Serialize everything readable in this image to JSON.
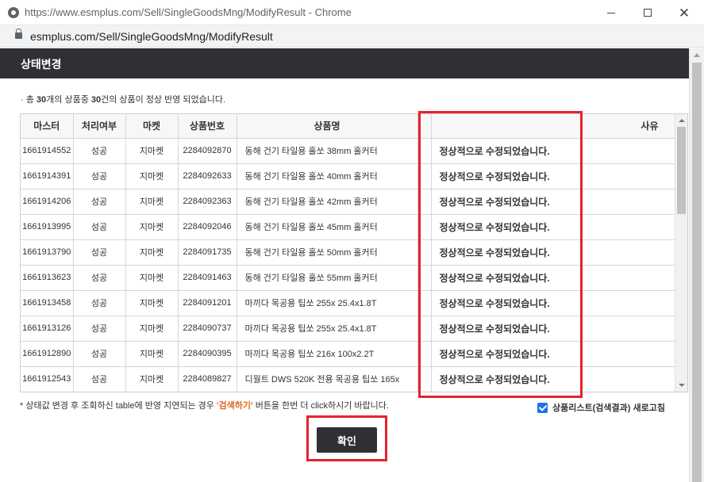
{
  "window": {
    "title": "https://www.esmplus.com/Sell/SingleGoodsMng/ModifyResult - Chrome",
    "url": "esmplus.com/Sell/SingleGoodsMng/ModifyResult"
  },
  "dialog": {
    "title": "상태변경"
  },
  "summary": {
    "bullet": "·",
    "prefix": " 총 ",
    "total": "30",
    "middle": "개의 상품중 ",
    "success": "30",
    "suffix": "건의 상품이 정상 반영 되었습니다."
  },
  "table": {
    "headers": {
      "master": "마스터",
      "status": "처리여부",
      "market": "마켓",
      "goods_no": "상품번호",
      "goods_name": "상품명",
      "reason": "사유"
    },
    "rows": [
      {
        "master": "1661914552",
        "status": "성공",
        "market": "지마켓",
        "goods_no": "2284092870",
        "name": "동해 건기 타일용 홀쏘 38mm 홀커터",
        "reason": "정상적으로 수정되었습니다."
      },
      {
        "master": "1661914391",
        "status": "성공",
        "market": "지마켓",
        "goods_no": "2284092633",
        "name": "동해 건기 타일용 홀쏘 40mm 홀커터",
        "reason": "정상적으로 수정되었습니다."
      },
      {
        "master": "1661914206",
        "status": "성공",
        "market": "지마켓",
        "goods_no": "2284092363",
        "name": "동해 건기 타일용 홀쏘 42mm 홀커터",
        "reason": "정상적으로 수정되었습니다."
      },
      {
        "master": "1661913995",
        "status": "성공",
        "market": "지마켓",
        "goods_no": "2284092046",
        "name": "동해 건기 타일용 홀쏘 45mm 홀커터",
        "reason": "정상적으로 수정되었습니다."
      },
      {
        "master": "1661913790",
        "status": "성공",
        "market": "지마켓",
        "goods_no": "2284091735",
        "name": "동해 건기 타일용 홀쏘 50mm 홀커터",
        "reason": "정상적으로 수정되었습니다."
      },
      {
        "master": "1661913623",
        "status": "성공",
        "market": "지마켓",
        "goods_no": "2284091463",
        "name": "동해 건기 타일용 홀쏘 55mm 홀커터",
        "reason": "정상적으로 수정되었습니다."
      },
      {
        "master": "1661913458",
        "status": "성공",
        "market": "지마켓",
        "goods_no": "2284091201",
        "name": "마끼다 목공용 팁쏘 255x 25.4x1.8T",
        "reason": "정상적으로 수정되었습니다."
      },
      {
        "master": "1661913126",
        "status": "성공",
        "market": "지마켓",
        "goods_no": "2284090737",
        "name": "마끼다 목공용 팁쏘 255x 25.4x1.8T",
        "reason": "정상적으로 수정되었습니다."
      },
      {
        "master": "1661912890",
        "status": "성공",
        "market": "지마켓",
        "goods_no": "2284090395",
        "name": "마끼다 목공용 팁쏘 216x 100x2.2T",
        "reason": "정상적으로 수정되었습니다."
      },
      {
        "master": "1661912543",
        "status": "성공",
        "market": "지마켓",
        "goods_no": "2284089827",
        "name": "디월트 DWS 520K 전용 목공용 팁쏘 165x",
        "reason": "정상적으로 수정되었습니다."
      }
    ]
  },
  "note": {
    "prefix": "* 상태값 변경 후 조회하신 table에 반영 지연되는 경우 ",
    "accent": "'검색하기'",
    "suffix": " 버튼을 한번 더 click하시기 바랍니다."
  },
  "refresh": {
    "label": "상품리스트(검색결과) 새로고침",
    "checked": true
  },
  "confirm": {
    "label": "확인"
  },
  "colors": {
    "highlight": "#e8222b",
    "header_bg": "#2f2f34",
    "accent": "#e0661a",
    "checkbox": "#1a73e8"
  }
}
